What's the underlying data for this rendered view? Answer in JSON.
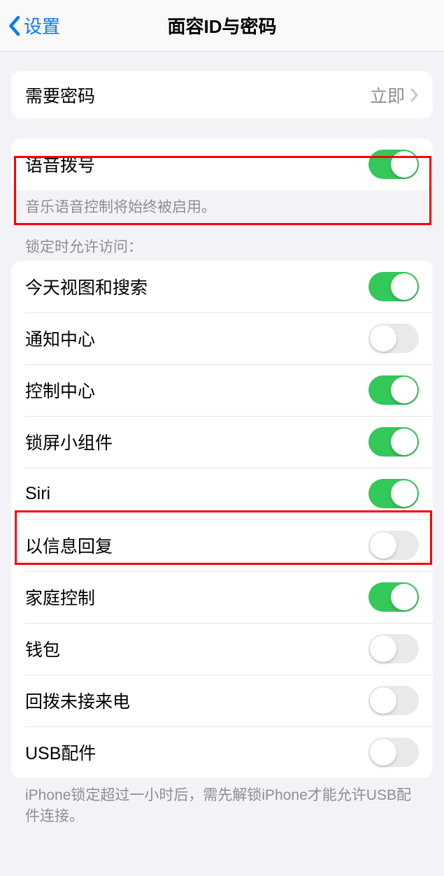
{
  "header": {
    "back_label": "设置",
    "title": "面容ID与密码"
  },
  "require_passcode": {
    "label": "需要密码",
    "value": "立即"
  },
  "voice_dial": {
    "label": "语音拨号",
    "on": true,
    "footer": "音乐语音控制将始终被启用。"
  },
  "allow_access_header": "锁定时允许访问：",
  "allow_access": [
    {
      "label": "今天视图和搜索",
      "on": true
    },
    {
      "label": "通知中心",
      "on": false
    },
    {
      "label": "控制中心",
      "on": true
    },
    {
      "label": "锁屏小组件",
      "on": true
    },
    {
      "label": "Siri",
      "on": true
    },
    {
      "label": "以信息回复",
      "on": false
    },
    {
      "label": "家庭控制",
      "on": true
    },
    {
      "label": "钱包",
      "on": false
    },
    {
      "label": "回拨未接来电",
      "on": false
    },
    {
      "label": "USB配件",
      "on": false
    }
  ],
  "usb_footer": "iPhone锁定超过一小时后，需先解锁iPhone才能允许USB配件连接。"
}
